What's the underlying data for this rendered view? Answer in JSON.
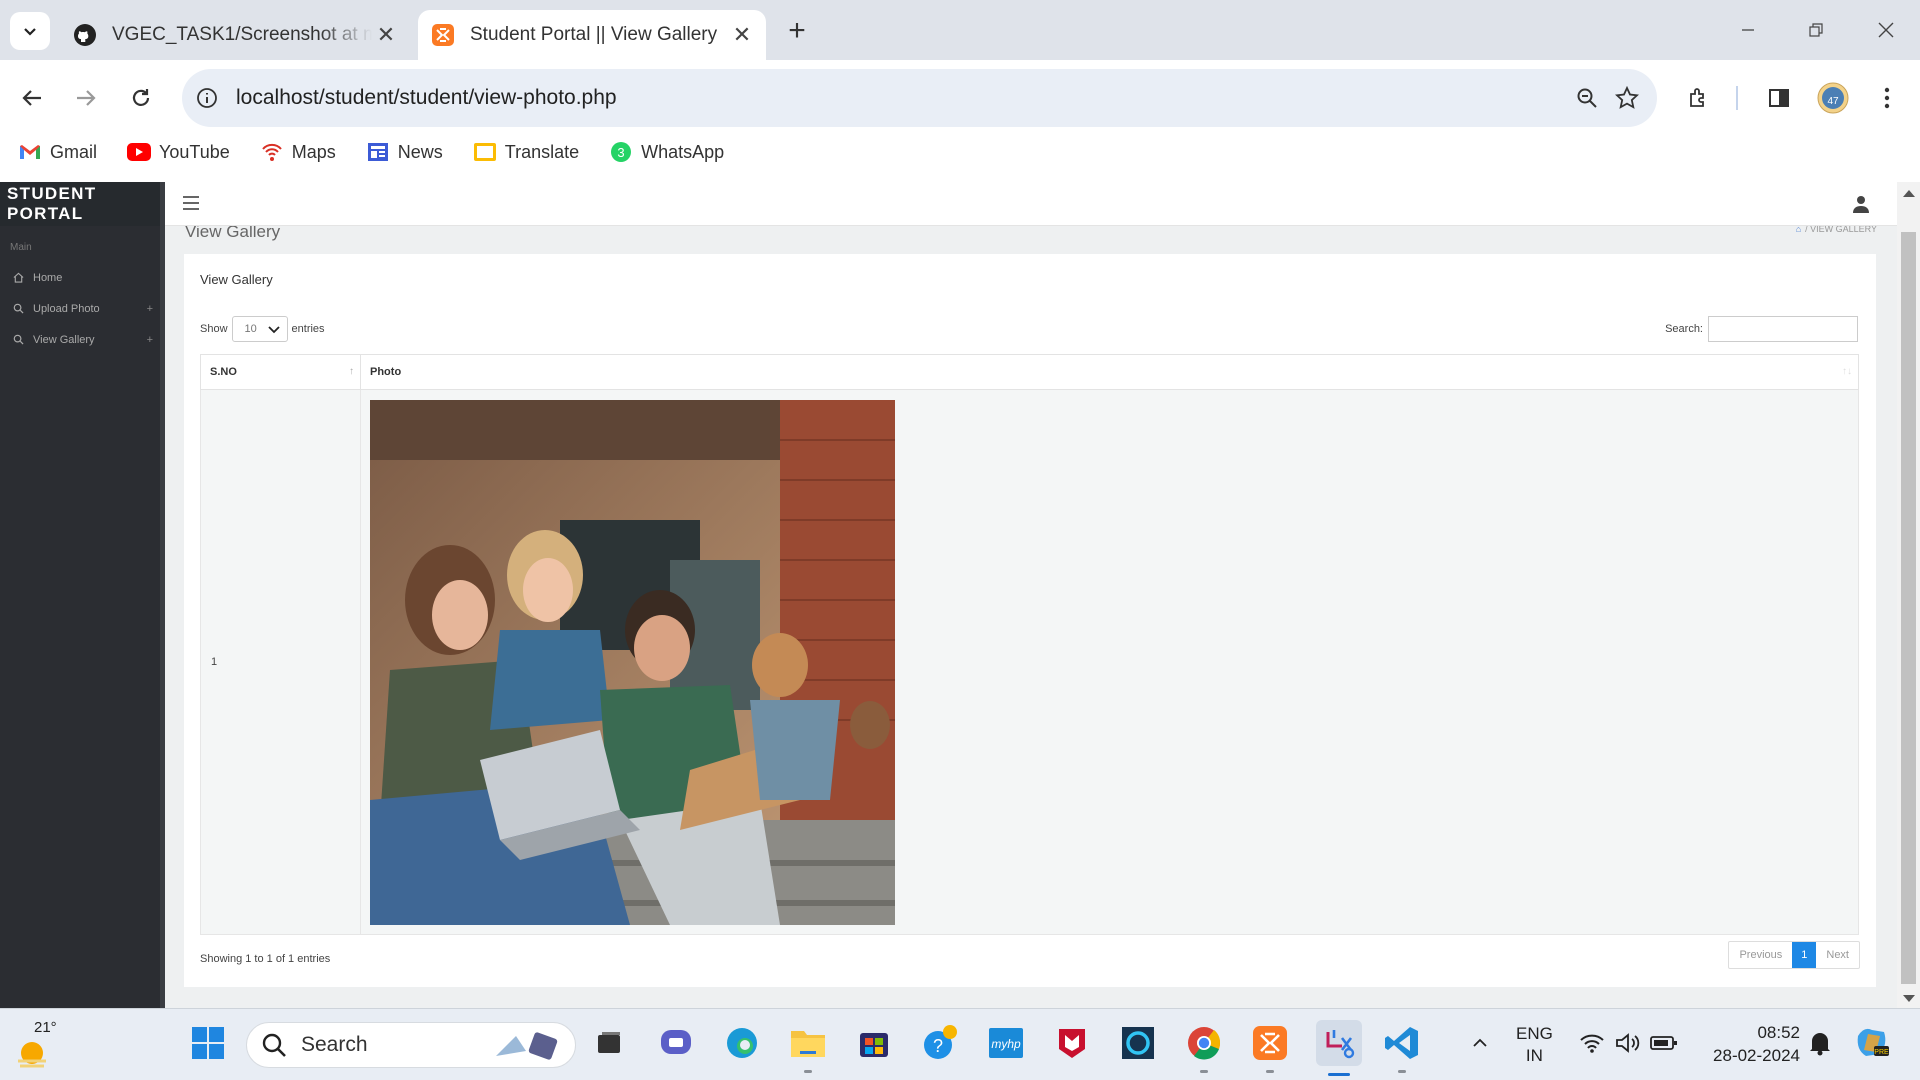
{
  "browser": {
    "tabs": [
      {
        "title": "VGEC_TASK1/Screenshot at mai",
        "active": false,
        "icon": "github-icon"
      },
      {
        "title": "Student Portal || View Gallery",
        "active": true,
        "icon": "xampp-icon"
      }
    ],
    "url": "localhost/student/student/view-photo.php",
    "bookmarks": [
      {
        "label": "Gmail",
        "icon": "gmail-icon"
      },
      {
        "label": "YouTube",
        "icon": "youtube-icon"
      },
      {
        "label": "Maps",
        "icon": "maps-icon"
      },
      {
        "label": "News",
        "icon": "news-icon"
      },
      {
        "label": "Translate",
        "icon": "translate-icon"
      },
      {
        "label": "WhatsApp",
        "icon": "whatsapp-icon"
      }
    ],
    "profile_badge": "47"
  },
  "portal": {
    "brand": "STUDENT PORTAL",
    "section_label": "Main",
    "menu": [
      {
        "label": "Home",
        "icon": "home-icon",
        "plus": ""
      },
      {
        "label": "Upload Photo",
        "icon": "search-icon",
        "plus": "+"
      },
      {
        "label": "View Gallery",
        "icon": "search-icon",
        "plus": "+"
      }
    ],
    "page_title": "View Gallery",
    "breadcrumb": "/ VIEW GALLERY",
    "card_title": "View Gallery",
    "show_label": "Show",
    "entries_label": "entries",
    "page_length": "10",
    "search_label": "Search:",
    "search_value": "",
    "columns": [
      "S.NO",
      "Photo"
    ],
    "rows": [
      {
        "sno": "1",
        "photo": "students-photo"
      }
    ],
    "info": "Showing 1 to 1 of 1 entries",
    "pager": {
      "previous": "Previous",
      "current": "1",
      "next": "Next"
    }
  },
  "taskbar": {
    "temperature": "21°",
    "search_placeholder": "Search",
    "lang_top": "ENG",
    "lang_bottom": "IN",
    "time": "08:52",
    "date": "28-02-2024"
  }
}
